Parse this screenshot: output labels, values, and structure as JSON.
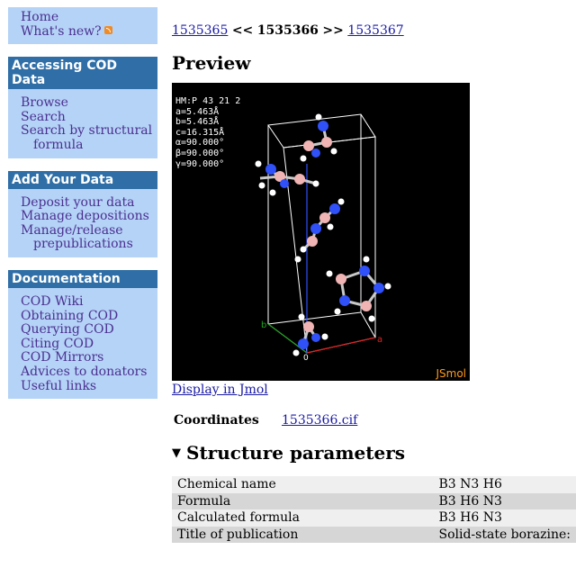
{
  "sidebar": {
    "top": {
      "items": [
        {
          "label": "Home"
        },
        {
          "label": "What's new?"
        }
      ]
    },
    "accessing": {
      "title": "Accessing COD Data",
      "items": [
        {
          "label": "Browse"
        },
        {
          "label": "Search"
        },
        {
          "label": "Search by structural formula"
        }
      ]
    },
    "add": {
      "title": "Add Your Data",
      "items": [
        {
          "label": "Deposit your data"
        },
        {
          "label": "Manage depositions"
        },
        {
          "label": "Manage/release prepublications"
        }
      ]
    },
    "docs": {
      "title": "Documentation",
      "items": [
        {
          "label": "COD Wiki"
        },
        {
          "label": "Obtaining COD"
        },
        {
          "label": "Querying COD"
        },
        {
          "label": "Citing COD"
        },
        {
          "label": "COD Mirrors"
        },
        {
          "label": "Advices to donators"
        },
        {
          "label": "Useful links"
        }
      ]
    }
  },
  "nav": {
    "prev": "1535365",
    "current": "1535366",
    "next": "1535367",
    "prev_sep": "<<",
    "next_sep": ">>"
  },
  "preview": {
    "title": "Preview",
    "cell_info": [
      "HM:P 43 21 2",
      "a=5.463Å",
      "b=5.463Å",
      "c=16.315Å",
      "α=90.000°",
      "β=90.000°",
      "γ=90.000°"
    ],
    "axis_labels": {
      "a": "a",
      "b": "b",
      "c": "c",
      "origin": "0"
    },
    "brand": "JSmol",
    "display_link": "Display in Jmol"
  },
  "coordinates": {
    "label": "Coordinates",
    "file": "1535366.cif"
  },
  "structure": {
    "title": "Structure parameters",
    "rows": [
      {
        "key": "Chemical name",
        "value": "B3 N3 H6"
      },
      {
        "key": "Formula",
        "value": "B3 H6 N3"
      },
      {
        "key": "Calculated formula",
        "value": "B3 H6 N3"
      },
      {
        "key": "Title of publication",
        "value": "Solid-state borazine:"
      }
    ]
  },
  "colors": {
    "sidebar_bg": "#b4d3f7",
    "sidebar_title_bg": "#2f6ea6",
    "link": "#1a1aa6",
    "sidebar_link": "#4b2f8f",
    "boron": "#f0b4b4",
    "nitrogen": "#3050f8",
    "hydrogen": "#ffffff"
  }
}
